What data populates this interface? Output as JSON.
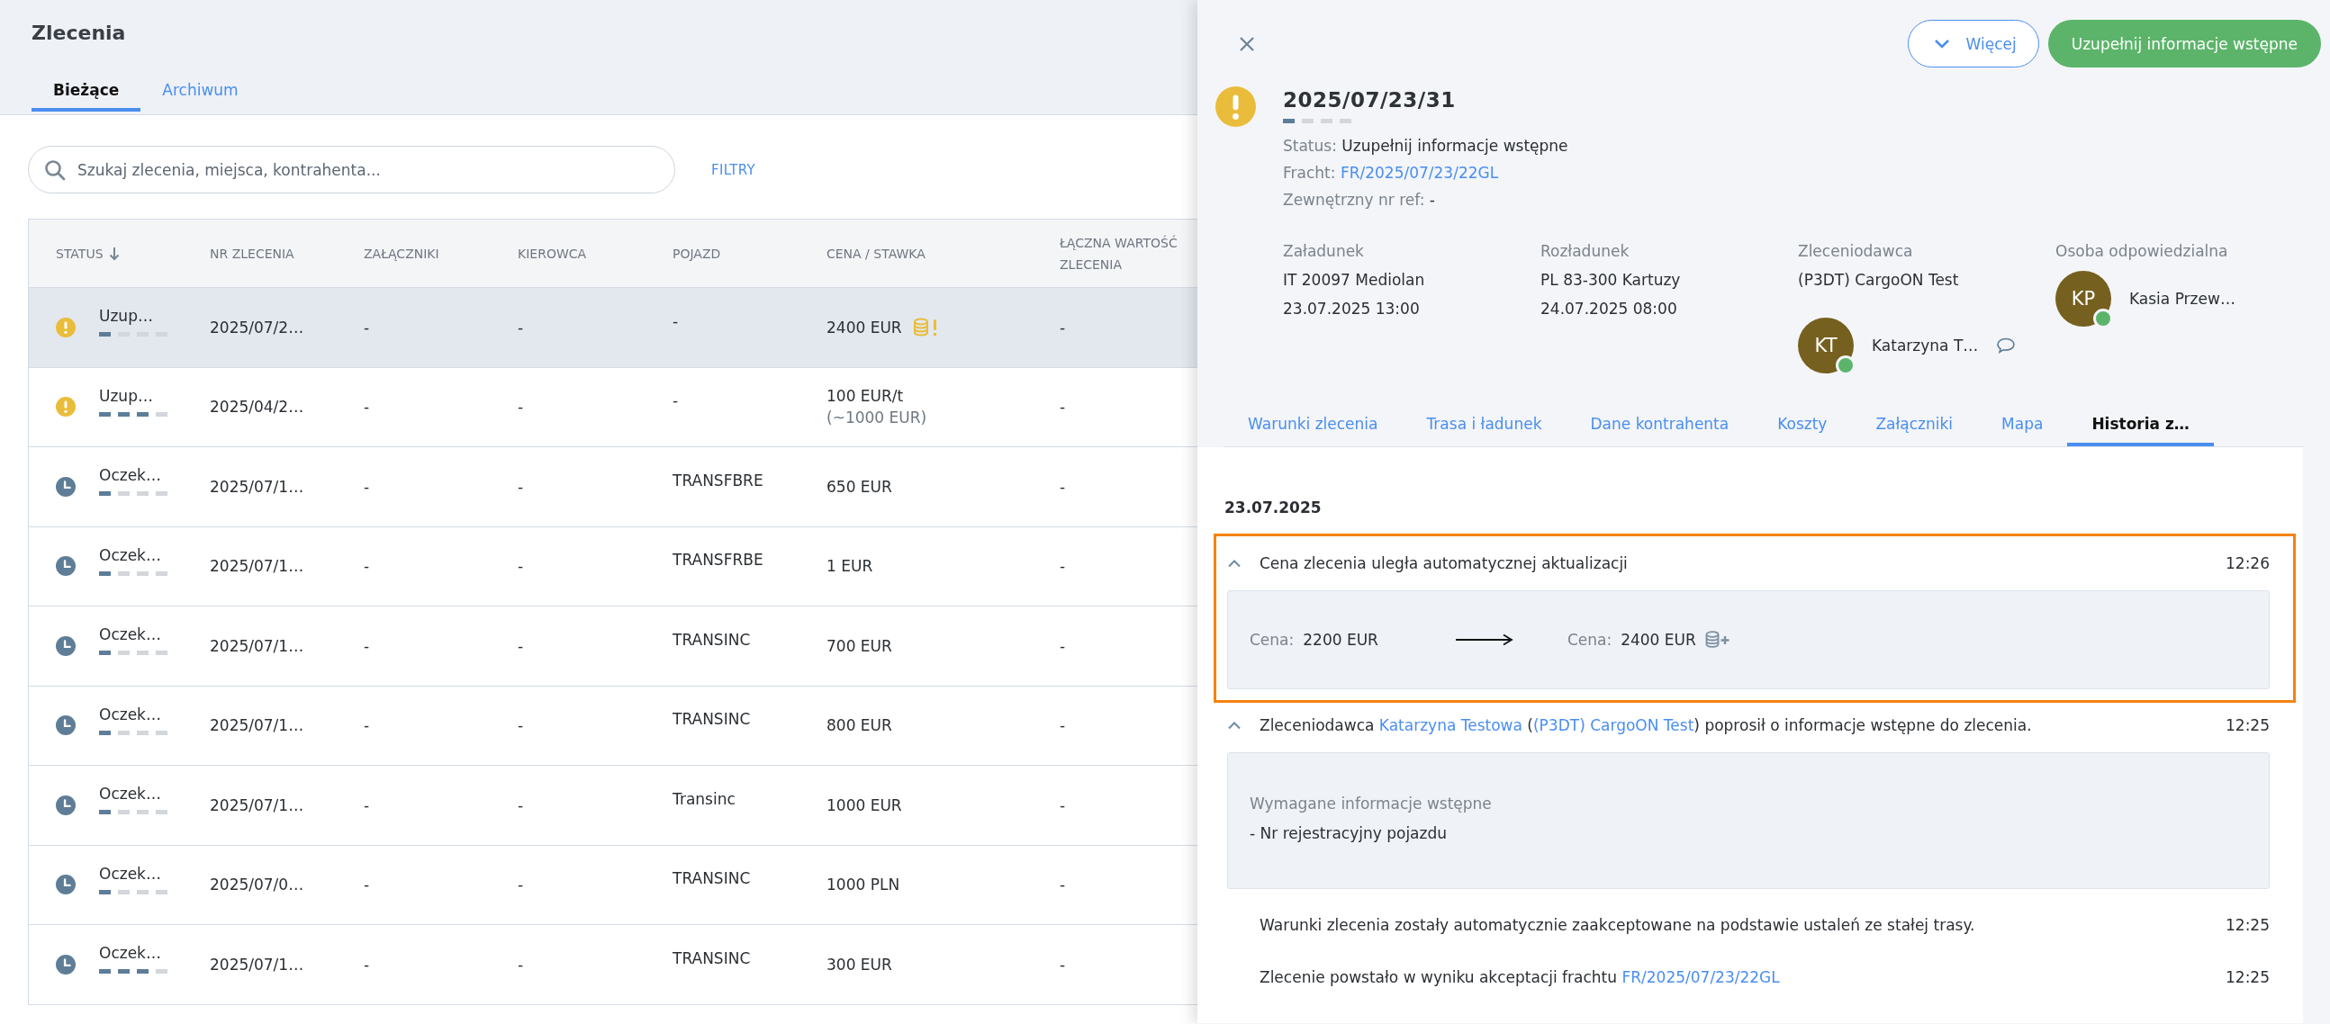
{
  "page": {
    "title": "Zlecenia"
  },
  "tabs": [
    {
      "label": "Bieżące",
      "selected": true
    },
    {
      "label": "Archiwum",
      "selected": false
    }
  ],
  "search": {
    "placeholder": "Szukaj zlecenia, miejsca, kontrahenta..."
  },
  "filters_link": "FILTRY",
  "table": {
    "columns": [
      {
        "label": "STATUS",
        "sorted": true
      },
      {
        "label": "NR ZLECENIA",
        "sorted": false
      },
      {
        "label": "ZAŁĄCZNIKI",
        "sorted": false
      },
      {
        "label": "KIEROWCA",
        "sorted": false
      },
      {
        "label": "POJAZD",
        "sorted": false
      },
      {
        "label": "CENA / STAWKA",
        "sorted": false
      },
      {
        "label": "ŁĄCZNA WARTOŚĆ ZLECENIA",
        "sorted": false
      }
    ],
    "rows": [
      {
        "selected": true,
        "kind": "warning",
        "status": "Uzup…",
        "level": 0.25,
        "number": "2025/07/2…",
        "attachments": "-",
        "driver": "-",
        "vehicle": "-",
        "price": "2400 EUR",
        "price_alert": true,
        "total": "-"
      },
      {
        "selected": false,
        "kind": "warning",
        "status": "Uzup…",
        "level": 0.75,
        "number": "2025/04/2…",
        "attachments": "-",
        "driver": "-",
        "vehicle": "-",
        "price": "100 EUR/t",
        "price_note": "(~1000 EUR)",
        "price_alert": false,
        "total": "-"
      },
      {
        "selected": false,
        "kind": "clock",
        "status": "Oczek…",
        "level": 0.25,
        "number": "2025/07/1…",
        "attachments": "-",
        "driver": "-",
        "vehicle": "TRANSFBRE",
        "price": "650 EUR",
        "price_alert": false,
        "total": "-"
      },
      {
        "selected": false,
        "kind": "clock",
        "status": "Oczek…",
        "level": 0.25,
        "number": "2025/07/1…",
        "attachments": "-",
        "driver": "-",
        "vehicle": "TRANSFRBE",
        "price": "1 EUR",
        "price_alert": false,
        "total": "-"
      },
      {
        "selected": false,
        "kind": "clock",
        "status": "Oczek…",
        "level": 0.25,
        "number": "2025/07/1…",
        "attachments": "-",
        "driver": "-",
        "vehicle": "TRANSINC",
        "price": "700 EUR",
        "price_alert": false,
        "total": "-"
      },
      {
        "selected": false,
        "kind": "clock",
        "status": "Oczek…",
        "level": 0.25,
        "number": "2025/07/1…",
        "attachments": "-",
        "driver": "-",
        "vehicle": "TRANSINC",
        "price": "800 EUR",
        "price_alert": false,
        "total": "-"
      },
      {
        "selected": false,
        "kind": "clock",
        "status": "Oczek…",
        "level": 0.25,
        "number": "2025/07/1…",
        "attachments": "-",
        "driver": "-",
        "vehicle": "Transinc",
        "price": "1000 EUR",
        "price_alert": false,
        "total": "-"
      },
      {
        "selected": false,
        "kind": "clock",
        "status": "Oczek…",
        "level": 0.25,
        "number": "2025/07/0…",
        "attachments": "-",
        "driver": "-",
        "vehicle": "TRANSINC",
        "price": "1000 PLN",
        "price_alert": false,
        "total": "-"
      },
      {
        "selected": false,
        "kind": "clock",
        "status": "Oczek…",
        "level": 0.75,
        "number": "2025/07/1…",
        "attachments": "-",
        "driver": "-",
        "vehicle": "TRANSINC",
        "price": "300 EUR",
        "price_alert": false,
        "total": "-"
      }
    ]
  },
  "drawer": {
    "more_button": "Więcej",
    "action_button": "Uzupełnij informacje wstępne",
    "status_badge": {
      "kind": "warning"
    },
    "number": "2025/07/23/31",
    "level": 0.25,
    "fields": [
      {
        "label": "Status:",
        "value": "Uzupełnij informacje wstępne",
        "kind": "text"
      },
      {
        "label": "Fracht:",
        "value": "FR/2025/07/23/22GL",
        "kind": "link"
      },
      {
        "label": "Zewnętrzny nr ref:",
        "value": "-",
        "kind": "text"
      }
    ],
    "parties": [
      {
        "label": "Załadunek",
        "lines": [
          "IT 20097 Mediolan",
          "23.07.2025 13:00"
        ]
      },
      {
        "label": "Rozładunek",
        "lines": [
          "PL 83-300 Kartuzy",
          "24.07.2025 08:00"
        ]
      },
      {
        "label": "Zleceniodawca",
        "lines": [
          "(P3DT) CargoON Test"
        ],
        "person": {
          "initials": "KT",
          "name": "Katarzyna T…",
          "online": true,
          "chat": true
        }
      },
      {
        "label": "Osoba odpowiedzialna",
        "person": {
          "initials": "KP",
          "name": "Kasia Przew…",
          "online": true,
          "chat": false
        }
      }
    ],
    "tabs": [
      {
        "label": "Warunki zlecenia",
        "selected": false
      },
      {
        "label": "Trasa i ładunek",
        "selected": false
      },
      {
        "label": "Dane kontrahenta",
        "selected": false
      },
      {
        "label": "Koszty",
        "selected": false
      },
      {
        "label": "Załączniki",
        "selected": false
      },
      {
        "label": "Mapa",
        "selected": false
      },
      {
        "label": "Historia z…",
        "selected": true
      }
    ],
    "history": {
      "date": "23.07.2025",
      "items": [
        {
          "kind": "price_change",
          "expanded": true,
          "highlighted": true,
          "parts": [
            {
              "kind": "text",
              "text": "Cena zlecenia uległa automatycznej aktualizacji"
            }
          ],
          "time": "12:26",
          "old": {
            "label": "Cena:",
            "value": "2200 EUR"
          },
          "new": {
            "label": "Cena:",
            "value": "2400 EUR"
          }
        },
        {
          "kind": "request",
          "expanded": true,
          "highlighted": false,
          "parts": [
            {
              "kind": "text",
              "text": "Zleceniodawca "
            },
            {
              "kind": "link",
              "text": "Katarzyna Testowa"
            },
            {
              "kind": "text",
              "text": " ("
            },
            {
              "kind": "link",
              "text": "(P3DT) CargoON Test"
            },
            {
              "kind": "text",
              "text": ") poprosił o informacje wstępne do zlecenia."
            }
          ],
          "time": "12:25",
          "details_title": "Wymagane informacje wstępne",
          "details_lines": [
            "- Nr rejestracyjny pojazdu"
          ]
        },
        {
          "kind": "note",
          "highlighted": false,
          "parts": [
            {
              "kind": "text",
              "text": "Warunki zlecenia zostały automatycznie zaakceptowane na podstawie ustaleń ze stałej trasy."
            }
          ],
          "time": "12:25"
        },
        {
          "kind": "note",
          "highlighted": false,
          "parts": [
            {
              "kind": "text",
              "text": "Zlecenie powstało w wyniku akceptacji frachtu "
            },
            {
              "kind": "link",
              "text": "FR/2025/07/23/22GL"
            }
          ],
          "time": "12:25"
        }
      ]
    }
  }
}
